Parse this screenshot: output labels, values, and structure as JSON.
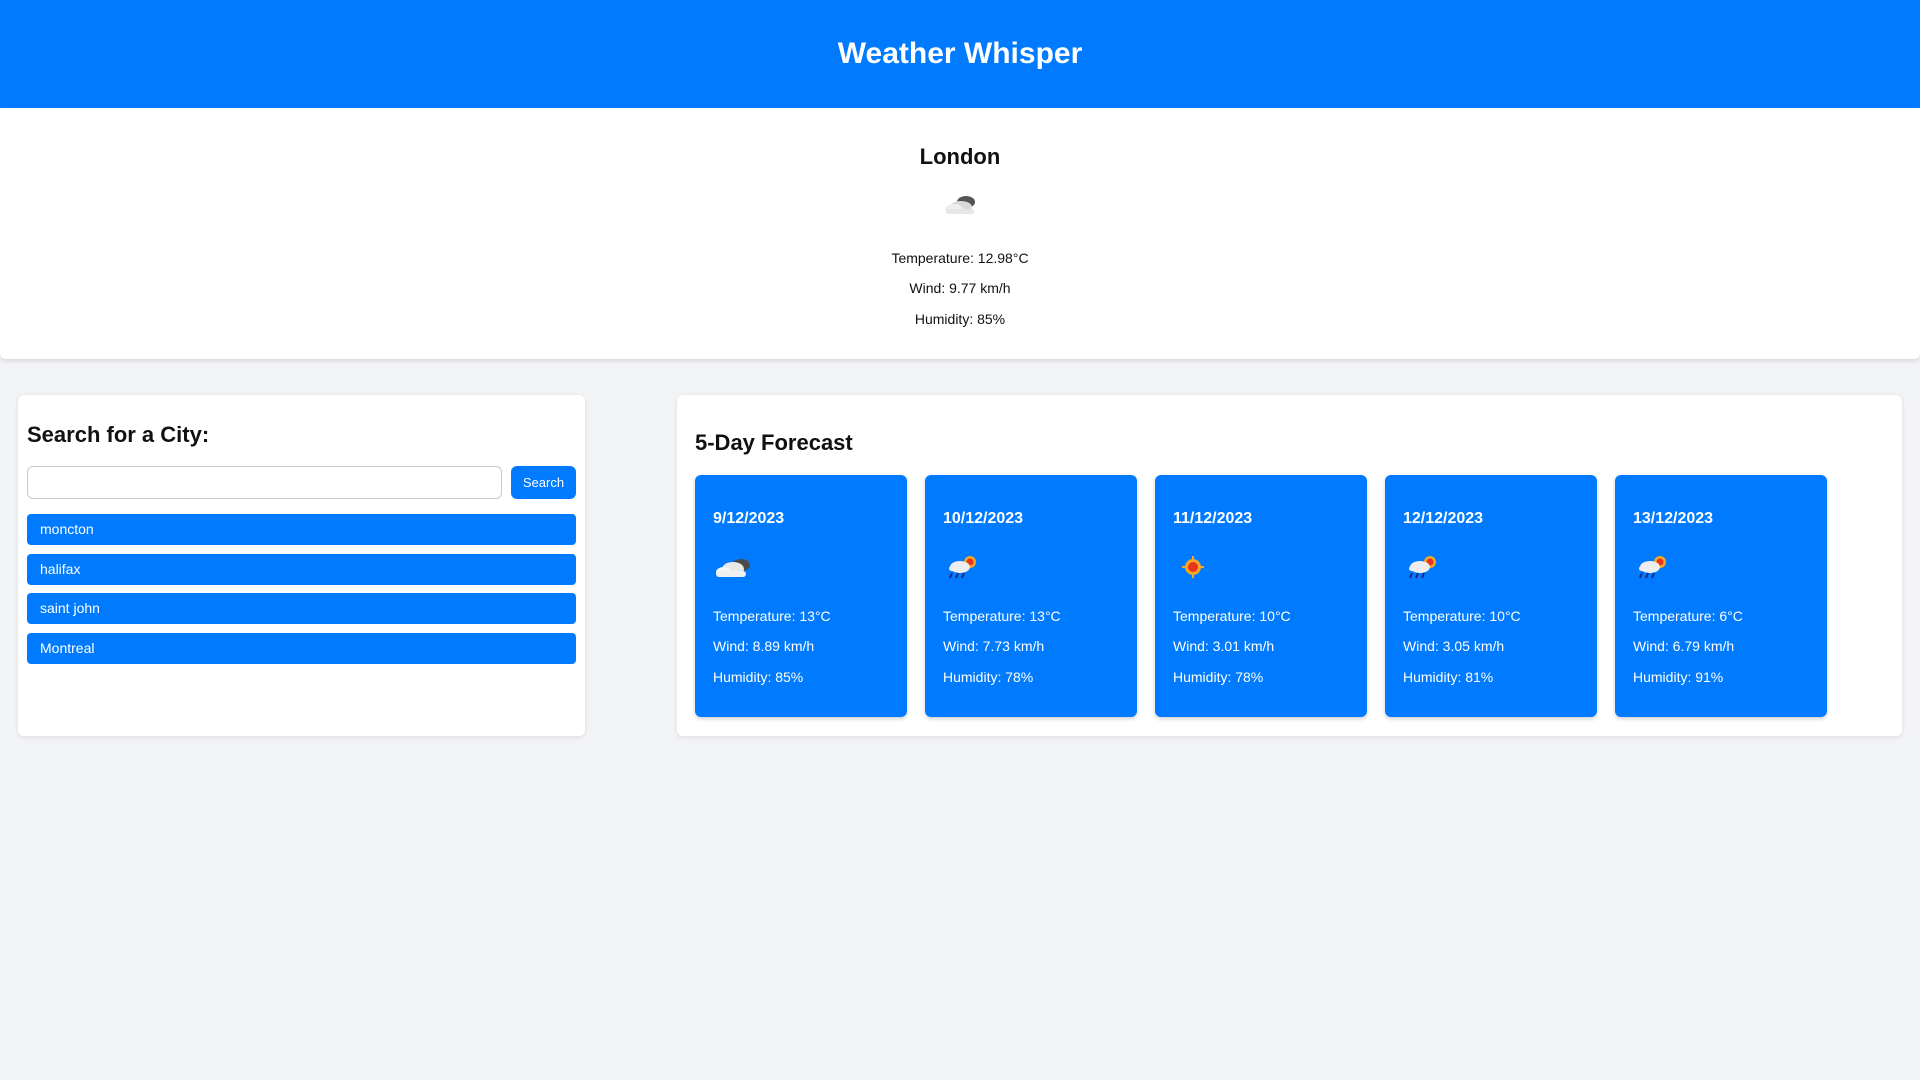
{
  "header": {
    "title": "Weather Whisper"
  },
  "current": {
    "city": "London",
    "icon": "partly-cloudy-night-icon",
    "temperature": "Temperature: 12.98°C",
    "wind": "Wind: 9.77 km/h",
    "humidity": "Humidity: 85%"
  },
  "search": {
    "heading": "Search for a City:",
    "input_value": "",
    "button_label": "Search",
    "history": [
      "moncton",
      "halifax",
      "saint john",
      "Montreal"
    ]
  },
  "forecast": {
    "heading": "5-Day Forecast",
    "days": [
      {
        "date": "9/12/2023",
        "icon": "cloudy-icon",
        "temperature": "Temperature: 13°C",
        "wind": "Wind: 8.89 km/h",
        "humidity": "Humidity: 85%"
      },
      {
        "date": "10/12/2023",
        "icon": "sun-rain-icon",
        "temperature": "Temperature: 13°C",
        "wind": "Wind: 7.73 km/h",
        "humidity": "Humidity: 78%"
      },
      {
        "date": "11/12/2023",
        "icon": "sun-icon",
        "temperature": "Temperature: 10°C",
        "wind": "Wind: 3.01 km/h",
        "humidity": "Humidity: 78%"
      },
      {
        "date": "12/12/2023",
        "icon": "sun-rain-icon",
        "temperature": "Temperature: 10°C",
        "wind": "Wind: 3.05 km/h",
        "humidity": "Humidity: 81%"
      },
      {
        "date": "13/12/2023",
        "icon": "sun-rain-icon",
        "temperature": "Temperature: 6°C",
        "wind": "Wind: 6.79 km/h",
        "humidity": "Humidity: 91%"
      }
    ]
  },
  "colors": {
    "accent": "#007bff",
    "background": "#f2f3f5",
    "card": "#ffffff"
  }
}
